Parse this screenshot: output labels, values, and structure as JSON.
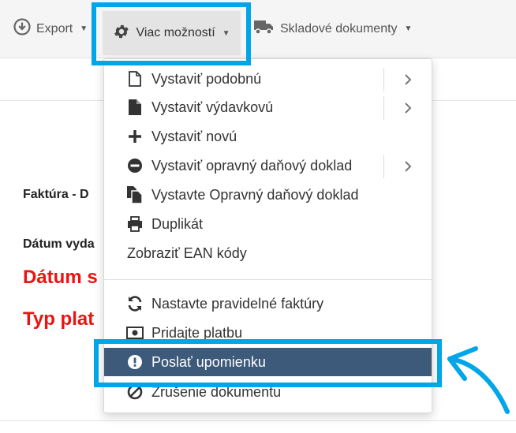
{
  "toolbar": {
    "export_label": "Export",
    "more_label": "Viac možností",
    "stock_label": "Skladové dokumenty"
  },
  "document": {
    "invoice_label": "Faktúra - D",
    "issued_label": "Dátum vyda",
    "date_label": "Dátum s",
    "type_label": "Typ plat"
  },
  "menu": {
    "items": [
      {
        "label": "Vystaviť podobnú",
        "icon": "file-outline-icon",
        "submenu": true
      },
      {
        "label": "Vystaviť výdavkovú",
        "icon": "file-solid-icon",
        "submenu": true
      },
      {
        "label": "Vystaviť novú",
        "icon": "plus-icon",
        "submenu": false
      },
      {
        "label": "Vystaviť opravný daňový doklad",
        "icon": "minus-circle-icon",
        "submenu": true
      },
      {
        "label": "Vystavte Opravný daňový doklad",
        "icon": "files-icon",
        "submenu": false
      },
      {
        "label": "Duplikát",
        "icon": "print-icon",
        "submenu": false
      },
      {
        "label": "Zobraziť EAN kódy",
        "icon": "",
        "submenu": false
      },
      {
        "label": "Nastavte pravidelné faktúry",
        "icon": "refresh-icon",
        "submenu": false
      },
      {
        "label": "Pridajte platbu",
        "icon": "money-icon",
        "submenu": false
      },
      {
        "label": "Poslať upomienku",
        "icon": "exclamation-circle-icon",
        "submenu": false,
        "active": true
      },
      {
        "label": "Zrušenie dokumentu",
        "icon": "ban-icon",
        "submenu": false
      }
    ]
  },
  "colors": {
    "highlight": "#00a6e8",
    "active_item": "#3d5a7a",
    "red_text": "#ee1111"
  }
}
